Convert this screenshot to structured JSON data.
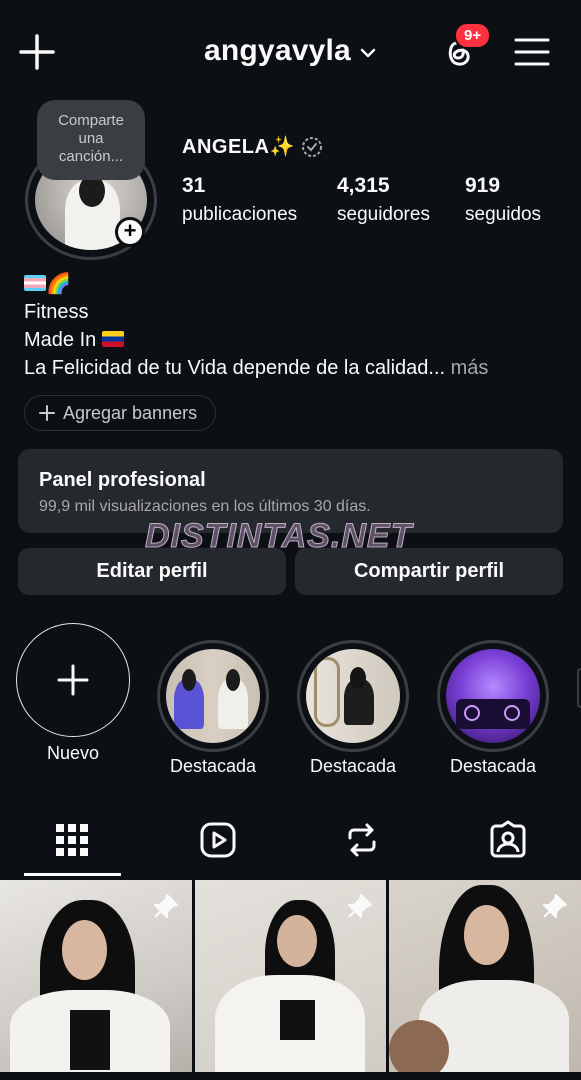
{
  "header": {
    "username": "angyavyla",
    "notification_badge": "9+",
    "badge_color": "#ff3040"
  },
  "profile": {
    "song_prompt_lines": [
      "Comparte",
      "una",
      "canción..."
    ],
    "display_name": "ANGELA✨",
    "stats": [
      {
        "value": "31",
        "label": "publicaciones"
      },
      {
        "value": "4,315",
        "label": "seguidores"
      },
      {
        "value": "919",
        "label": "seguidos"
      }
    ]
  },
  "bio": {
    "line1_emoji": "🌈",
    "line2": "Fitness",
    "line3": "Made In",
    "line4": "La Felicidad de tu Vida depende  de la calidad...",
    "more": "más"
  },
  "banners_button": "Agregar banners",
  "professional_panel": {
    "title": "Panel profesional",
    "subtitle": "99,9 mil visualizaciones en los últimos 30 días."
  },
  "watermark": "DISTINTAS.NET",
  "actions": {
    "edit": "Editar perfil",
    "share": "Compartir perfil"
  },
  "highlights": {
    "new_label": "Nuevo",
    "items": [
      {
        "label": "Destacada"
      },
      {
        "label": "Destacada"
      },
      {
        "label": "Destacada"
      }
    ]
  },
  "tabs": [
    {
      "icon": "grid-icon",
      "active": true
    },
    {
      "icon": "reels-icon",
      "active": false
    },
    {
      "icon": "reposts-icon",
      "active": false
    },
    {
      "icon": "tagged-icon",
      "active": false
    }
  ],
  "colors": {
    "background": "#0c1014",
    "surface": "#25292e",
    "text": "#fafafa",
    "muted": "#a8a8a8"
  }
}
